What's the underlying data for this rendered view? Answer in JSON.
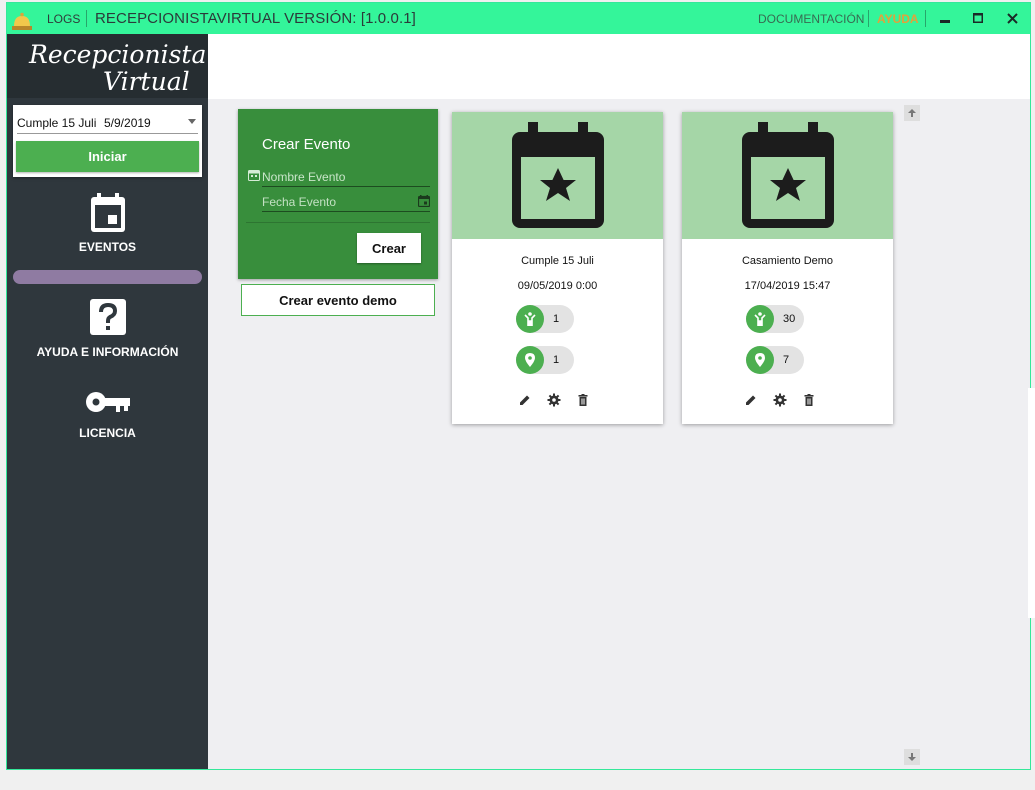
{
  "titlebar": {
    "logs": "LOGS",
    "app_title": "RECEPCIONISTAVIRTUAL VERSIÓN: [1.0.0.1]",
    "documentation": "DOCUMENTACIÓN",
    "help": "AYUDA"
  },
  "sidebar": {
    "logo_line1": "Recepcionista",
    "logo_line2": "Virtual",
    "selected_event": "Cumple 15 Juli",
    "selected_date": "5/9/2019",
    "start_label": "Iniciar",
    "items": [
      {
        "label": "EVENTOS",
        "icon": "calendar-icon"
      },
      {
        "label": "AYUDA E INFORMACIÓN",
        "icon": "help-icon"
      },
      {
        "label": "LICENCIA",
        "icon": "key-icon"
      }
    ]
  },
  "create_event": {
    "title": "Crear Evento",
    "name_placeholder": "Nombre Evento",
    "date_placeholder": "Fecha Evento",
    "create_label": "Crear",
    "demo_label": "Crear evento demo"
  },
  "events": [
    {
      "name": "Cumple 15 Juli",
      "date": "09/05/2019 0:00",
      "guests": "1",
      "places": "1"
    },
    {
      "name": "Casamiento Demo",
      "date": "17/04/2019 15:47",
      "guests": "30",
      "places": "7"
    }
  ],
  "colors": {
    "titlebar": "#34f59a",
    "sidebar": "#2f373d",
    "accent": "#4caf50",
    "create_card": "#388e3c",
    "event_image": "#a5d6a7",
    "help_text": "#e2a23b"
  }
}
